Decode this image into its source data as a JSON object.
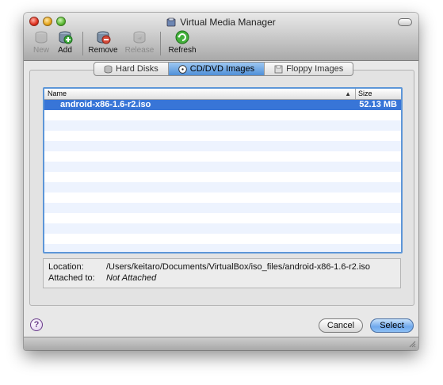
{
  "window": {
    "title": "Virtual Media Manager"
  },
  "toolbar": {
    "new_label": "New",
    "add_label": "Add",
    "remove_label": "Remove",
    "release_label": "Release",
    "refresh_label": "Refresh"
  },
  "tabs": [
    {
      "label": "Hard Disks",
      "icon": "hard-disk-icon"
    },
    {
      "label": "CD/DVD Images",
      "icon": "cd-icon"
    },
    {
      "label": "Floppy Images",
      "icon": "floppy-icon"
    }
  ],
  "active_tab": "CD/DVD Images",
  "table": {
    "headers": {
      "name": "Name",
      "size": "Size"
    },
    "sort_indicator": "▲",
    "rows": [
      {
        "name": "android-x86-1.6-r2.iso",
        "size": "52.13 MB",
        "selected": true
      }
    ]
  },
  "info": {
    "location_label": "Location:",
    "location_value": "/Users/keitaro/Documents/VirtualBox/iso_files/android-x86-1.6-r2.iso",
    "attached_label": "Attached to:",
    "attached_value": "Not Attached"
  },
  "buttons": {
    "help_label": "?",
    "cancel_label": "Cancel",
    "select_label": "Select"
  },
  "colors": {
    "selection": "#3875d7",
    "stripe": "#edf3fe",
    "primary_button": "#6fa8ec"
  }
}
